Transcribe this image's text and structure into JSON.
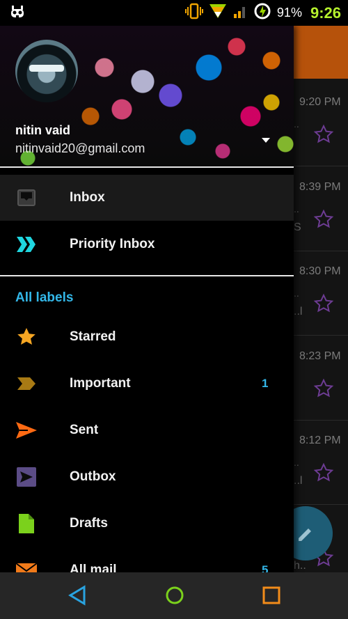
{
  "status_bar": {
    "battery": "91%",
    "time": "9:26"
  },
  "background_list": {
    "rows": [
      {
        "time": "9:20 PM",
        "dots": "..",
        "snippet": ""
      },
      {
        "time": "8:39 PM",
        "dots": "..",
        "snippet": "S"
      },
      {
        "time": "8:30 PM",
        "dots": "..",
        "snippet": "..l"
      },
      {
        "time": "8:23 PM",
        "dots": "",
        "snippet": ""
      },
      {
        "time": "8:12 PM",
        "dots": "..",
        "snippet": "..l"
      },
      {
        "time": "",
        "dots": "",
        "snippet": "h.."
      }
    ]
  },
  "drawer": {
    "account": {
      "name": "nitin vaid",
      "email": "nitinvaid20@gmail.com"
    },
    "primary": [
      {
        "label": "Inbox",
        "icon": "inbox-icon"
      },
      {
        "label": "Priority Inbox",
        "icon": "priority-inbox-icon"
      }
    ],
    "section_title": "All labels",
    "labels": [
      {
        "label": "Starred",
        "icon": "star-icon",
        "count": ""
      },
      {
        "label": "Important",
        "icon": "important-icon",
        "count": "1"
      },
      {
        "label": "Sent",
        "icon": "sent-icon",
        "count": ""
      },
      {
        "label": "Outbox",
        "icon": "outbox-icon",
        "count": ""
      },
      {
        "label": "Drafts",
        "icon": "drafts-icon",
        "count": ""
      },
      {
        "label": "All mail",
        "icon": "all-mail-icon",
        "count": "5"
      }
    ]
  },
  "colors": {
    "accent": "#33b7e8",
    "toolbar": "#b6520b",
    "time": "#b5f12d"
  }
}
